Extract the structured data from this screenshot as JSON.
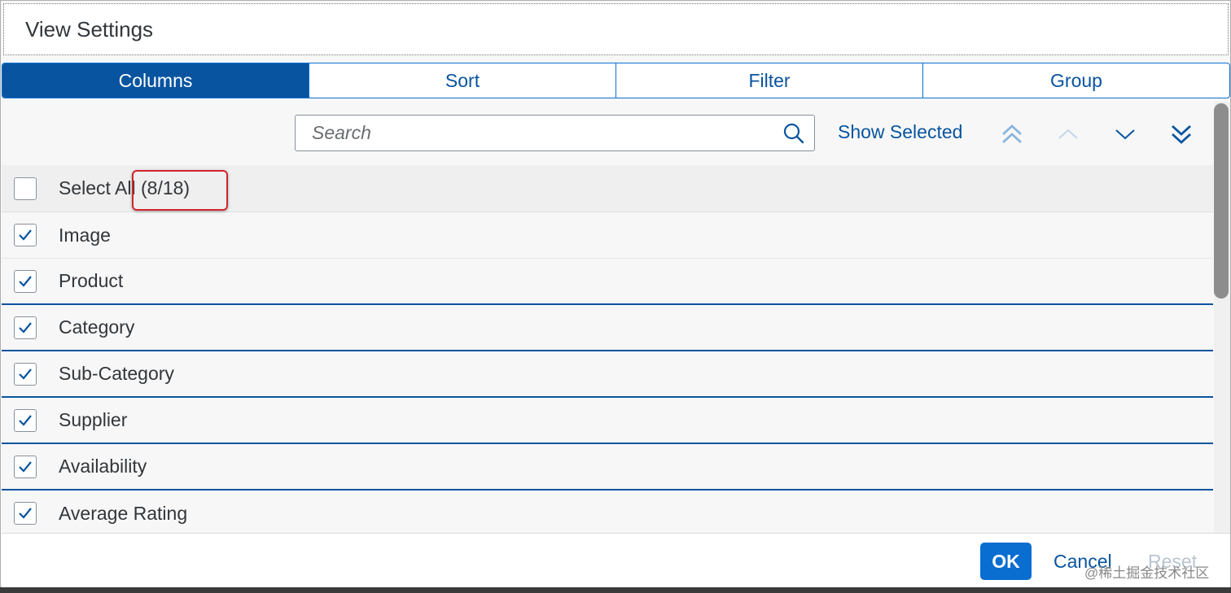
{
  "dialog": {
    "title": "View Settings"
  },
  "tabs": [
    {
      "label": "Columns",
      "active": true
    },
    {
      "label": "Sort",
      "active": false
    },
    {
      "label": "Filter",
      "active": false
    },
    {
      "label": "Group",
      "active": false
    }
  ],
  "toolbar": {
    "search_placeholder": "Search",
    "show_selected": "Show Selected",
    "move_buttons": [
      "move-to-top-icon",
      "move-up-icon",
      "move-down-icon",
      "move-to-bottom-icon"
    ]
  },
  "list": {
    "select_all_label": "Select All (8/18)",
    "select_all_checked": false,
    "items": [
      {
        "label": "Image",
        "checked": true
      },
      {
        "label": "Product",
        "checked": true
      },
      {
        "label": "Category",
        "checked": true
      },
      {
        "label": "Sub-Category",
        "checked": true
      },
      {
        "label": "Supplier",
        "checked": true
      },
      {
        "label": "Availability",
        "checked": true
      },
      {
        "label": "Average Rating",
        "checked": true
      }
    ]
  },
  "footer": {
    "ok_label": "OK",
    "cancel_label": "Cancel",
    "reset_label": "Reset",
    "watermark": "@稀土掘金技术社区"
  },
  "colors": {
    "accent": "#0854a0",
    "button": "#0a6ed1",
    "highlight": "#d0262c"
  }
}
